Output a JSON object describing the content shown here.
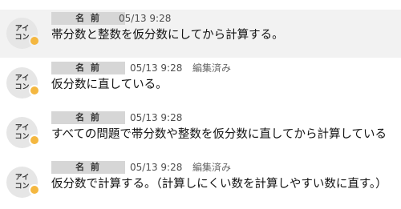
{
  "messages": [
    {
      "avatar": {
        "line1": "アイ",
        "line2": "コン"
      },
      "name": "名 前",
      "time": "05/13 9:28",
      "edited": "",
      "text": "帯分数と整数を仮分数にしてから計算する。"
    },
    {
      "avatar": {
        "line1": "アイ",
        "line2": "コン"
      },
      "name": "名 前",
      "time": "05/13 9:28",
      "edited": "編集済み",
      "text": "仮分数に直している。"
    },
    {
      "avatar": {
        "line1": "アイ",
        "line2": "コン"
      },
      "name": "名 前",
      "time": "05/13 9:28",
      "edited": "",
      "text": "すべての問題で帯分数や整数を仮分数に直してから計算している"
    },
    {
      "avatar": {
        "line1": "アイ",
        "line2": "コン"
      },
      "name": "名 前",
      "time": "05/13 9:28",
      "edited": "編集済み",
      "text": "仮分数で計算する。（計算しにくい数を計算しやすい数に直す。）"
    }
  ],
  "colors": {
    "row_shade": "#f2f2f2",
    "name_box": "#d6d6d6",
    "avatar_bg": "#e6e6e6",
    "status_dot": "#f4b740"
  }
}
